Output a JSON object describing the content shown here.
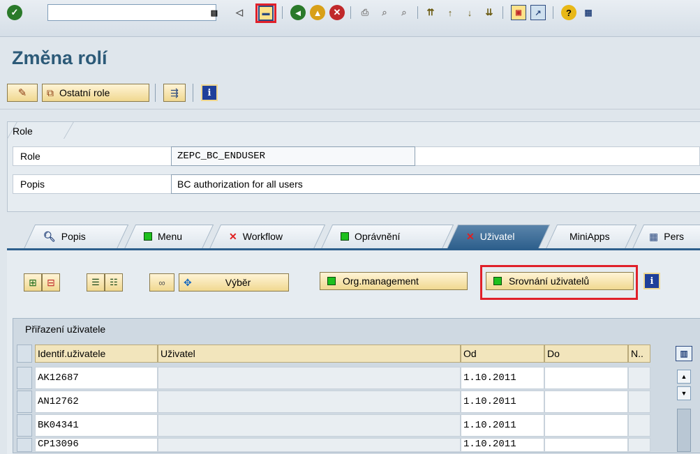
{
  "toolbar": {
    "command_field_value": "",
    "icons": [
      "enter-icon",
      "history-icon",
      "back-arrow-icon",
      "save-icon",
      "back-icon",
      "exit-icon",
      "cancel-icon",
      "print-icon",
      "find-icon",
      "find-next-icon",
      "first-page-icon",
      "prev-page-icon",
      "next-page-icon",
      "last-page-icon",
      "new-session-icon",
      "shortcut-icon",
      "help-icon",
      "layout-icon"
    ]
  },
  "page": {
    "title": "Změna rolí"
  },
  "appbar": {
    "other_roles_label": "Ostatní role"
  },
  "role_group": {
    "title": "Role",
    "role_label": "Role",
    "role_value": "ZEPC_BC_ENDUSER",
    "desc_label": "Popis",
    "desc_value": "BC authorization for all users"
  },
  "tabs": [
    {
      "label": "Popis",
      "status": "search"
    },
    {
      "label": "Menu",
      "status": "green"
    },
    {
      "label": "Workflow",
      "status": "red"
    },
    {
      "label": "Oprávnění",
      "status": "green"
    },
    {
      "label": "Uživatel",
      "status": "red",
      "active": true
    },
    {
      "label": "MiniApps",
      "status": "none"
    },
    {
      "label": "Pers",
      "status": "pers"
    }
  ],
  "panel": {
    "select_label": "Výběr",
    "org_label": "Org.management",
    "compare_label": "Srovnání uživatelů"
  },
  "table": {
    "title": "Přiřazení uživatele",
    "headers": [
      "Identif.uživatele",
      "Uživatel",
      "Od",
      "Do",
      "N.."
    ],
    "rows": [
      {
        "id": "AK12687",
        "user": "",
        "from": "1.10.2011",
        "to": ""
      },
      {
        "id": "AN12762",
        "user": "",
        "from": "1.10.2011",
        "to": ""
      },
      {
        "id": "BK04341",
        "user": "",
        "from": "1.10.2011",
        "to": ""
      },
      {
        "id": "CP13096",
        "user": "",
        "from": "1.10.2011",
        "to": ""
      }
    ]
  },
  "colors": {
    "highlight": "#e0202a",
    "accent": "#2d5f8c",
    "status_green": "#1ec01e"
  }
}
